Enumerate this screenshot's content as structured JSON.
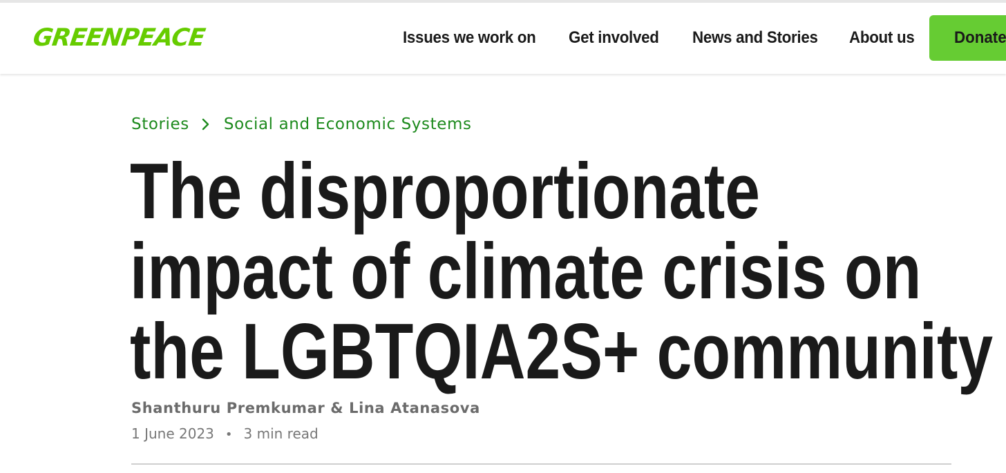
{
  "header": {
    "logo_text": "GREENPEACE",
    "nav": [
      {
        "label": "Issues we work on"
      },
      {
        "label": "Get involved"
      },
      {
        "label": "News and Stories"
      },
      {
        "label": "About us"
      }
    ],
    "donate_label": "Donate"
  },
  "breadcrumb": {
    "items": [
      {
        "label": "Stories"
      },
      {
        "label": "Social and Economic Systems"
      }
    ],
    "separator_icon": "chevron-right-icon"
  },
  "article": {
    "title_lines": [
      "The disproportionate",
      "impact of climate crisis on",
      "the LGBTQIA2S+ community"
    ],
    "authors": "Shanthuru Premkumar & Lina Atanasova",
    "date": "1 June 2023",
    "separator": "•",
    "read_time": "3 min read"
  },
  "colors": {
    "brand_green": "#66cc00",
    "donate_green": "#66cc33",
    "breadcrumb_green": "#1d8a1d",
    "text_dark": "#1a1a1a",
    "text_muted": "#6b6b6b"
  }
}
